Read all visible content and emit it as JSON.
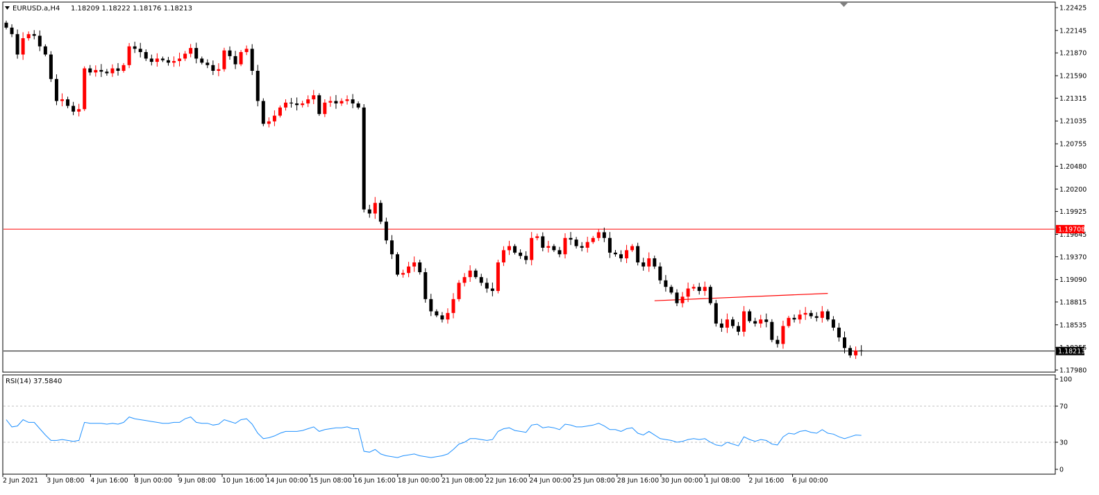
{
  "header": {
    "symbol_label": "EURUSD.a,H4",
    "ohlc": "1.18209 1.18222 1.18176 1.18213",
    "rsi_label": "RSI(14) 37.5840"
  },
  "colors": {
    "bull": "#ff0000",
    "bear": "#000000",
    "resistance": "#ff0000",
    "rsi_line": "#1e90ff",
    "price_tag": "#000000",
    "grid": "#c0c0c0"
  },
  "chart_data": [
    {
      "type": "candlestick",
      "symbol": "EURUSD.a",
      "timeframe": "H4",
      "ylim": [
        1.1798,
        1.22425
      ],
      "y_ticks": [
        "1.22425",
        "1.22145",
        "1.21870",
        "1.21590",
        "1.21315",
        "1.21035",
        "1.20755",
        "1.20480",
        "1.20200",
        "1.19925",
        "1.19645",
        "1.19370",
        "1.19090",
        "1.18815",
        "1.18535",
        "1.18255",
        "1.17980"
      ],
      "x_ticks": [
        "2 Jun 2021",
        "3 Jun 08:00",
        "4 Jun 16:00",
        "8 Jun 00:00",
        "9 Jun 08:00",
        "10 Jun 16:00",
        "14 Jun 00:00",
        "15 Jun 08:00",
        "16 Jun 16:00",
        "18 Jun 00:00",
        "21 Jun 08:00",
        "22 Jun 16:00",
        "24 Jun 00:00",
        "25 Jun 08:00",
        "28 Jun 16:00",
        "30 Jun 00:00",
        "1 Jul 08:00",
        "2 Jul 16:00",
        "6 Jul 00:00"
      ],
      "horizontal_lines": [
        {
          "price": 1.19708,
          "label": "1.19708",
          "color": "#ff0000"
        },
        {
          "price": 1.18213,
          "label": "1.18213",
          "color": "#000000"
        }
      ],
      "trendline": {
        "from_price": 1.1883,
        "to_price": 1.1892
      },
      "closes": [
        1.2218,
        1.221,
        1.2185,
        1.2205,
        1.221,
        1.2208,
        1.2195,
        1.2185,
        1.2155,
        1.2128,
        1.213,
        1.2122,
        1.2115,
        1.2118,
        1.2168,
        1.2163,
        1.2166,
        1.2164,
        1.2162,
        1.2168,
        1.2165,
        1.2172,
        1.2195,
        1.2192,
        1.2188,
        1.218,
        1.2176,
        1.218,
        1.2178,
        1.2175,
        1.2177,
        1.218,
        1.2186,
        1.2193,
        1.218,
        1.2175,
        1.2172,
        1.2165,
        1.2167,
        1.219,
        1.2183,
        1.2173,
        1.2188,
        1.2192,
        1.2165,
        1.2128,
        1.21,
        1.2103,
        1.211,
        1.212,
        1.2126,
        1.2125,
        1.2123,
        1.2125,
        1.213,
        1.2135,
        1.2112,
        1.2126,
        1.2128,
        1.2125,
        1.2128,
        1.213,
        1.2125,
        1.212,
        1.1995,
        1.199,
        1.2003,
        1.198,
        1.1957,
        1.194,
        1.1915,
        1.1917,
        1.1925,
        1.193,
        1.1918,
        1.1885,
        1.187,
        1.1865,
        1.186,
        1.1868,
        1.1885,
        1.1905,
        1.1912,
        1.192,
        1.1912,
        1.1905,
        1.1898,
        1.1895,
        1.193,
        1.1945,
        1.195,
        1.1942,
        1.1938,
        1.1933,
        1.196,
        1.1962,
        1.1948,
        1.195,
        1.1945,
        1.194,
        1.196,
        1.1958,
        1.195,
        1.1948,
        1.1955,
        1.196,
        1.1967,
        1.196,
        1.1942,
        1.194,
        1.1935,
        1.1945,
        1.195,
        1.193,
        1.1925,
        1.1935,
        1.1925,
        1.1908,
        1.19,
        1.1893,
        1.188,
        1.1888,
        1.1898,
        1.19,
        1.1895,
        1.19,
        1.188,
        1.1855,
        1.185,
        1.186,
        1.1852,
        1.1845,
        1.187,
        1.1858,
        1.1855,
        1.186,
        1.1857,
        1.1835,
        1.183,
        1.1852,
        1.1862,
        1.186,
        1.1866,
        1.1868,
        1.1864,
        1.1862,
        1.187,
        1.186,
        1.185,
        1.1838,
        1.1825,
        1.1816,
        1.1822,
        1.18213
      ],
      "rsi": {
        "name": "RSI(14)",
        "ylim": [
          0,
          100
        ],
        "y_ticks": [
          "100",
          "70",
          "30",
          "0"
        ],
        "levels": [
          70,
          30
        ],
        "values": [
          55,
          47,
          48,
          55,
          52,
          52,
          45,
          38,
          32,
          32,
          33,
          32,
          31,
          32,
          52,
          51,
          51,
          51,
          50,
          51,
          50,
          52,
          58,
          56,
          55,
          54,
          53,
          52,
          51,
          51,
          52,
          52,
          56,
          58,
          52,
          51,
          51,
          49,
          50,
          55,
          53,
          51,
          55,
          56,
          50,
          40,
          34,
          35,
          37,
          40,
          42,
          42,
          42,
          43,
          45,
          47,
          42,
          44,
          45,
          46,
          46,
          47,
          45,
          45,
          20,
          19,
          22,
          17,
          15,
          14,
          13,
          15,
          16,
          17,
          15,
          14,
          13,
          14,
          15,
          17,
          22,
          28,
          30,
          34,
          34,
          33,
          32,
          33,
          42,
          45,
          46,
          43,
          42,
          41,
          49,
          50,
          46,
          47,
          46,
          44,
          50,
          49,
          47,
          47,
          48,
          49,
          51,
          48,
          44,
          44,
          42,
          45,
          46,
          40,
          38,
          42,
          38,
          34,
          33,
          32,
          30,
          31,
          33,
          34,
          33,
          34,
          30,
          27,
          26,
          30,
          28,
          26,
          36,
          33,
          31,
          33,
          32,
          28,
          27,
          36,
          40,
          39,
          42,
          43,
          41,
          40,
          44,
          40,
          39,
          36,
          34,
          36,
          38,
          37.584
        ]
      }
    }
  ]
}
